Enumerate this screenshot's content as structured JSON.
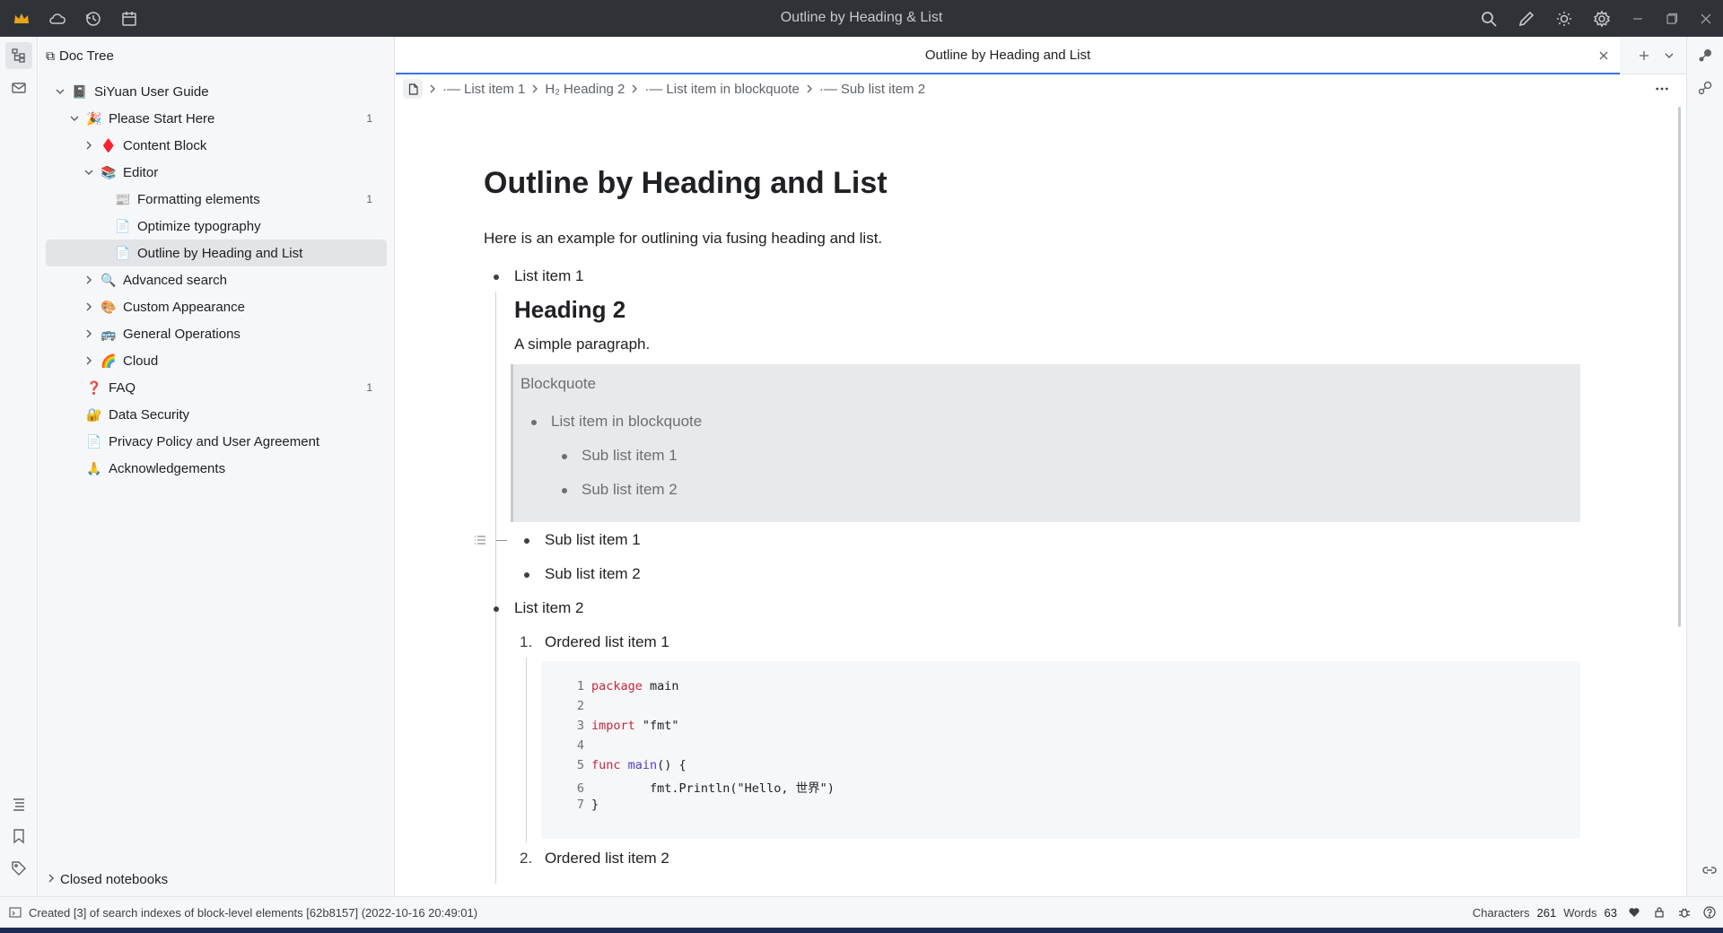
{
  "window": {
    "title": "Outline by Heading & List"
  },
  "titlebar": {
    "left_icons": [
      "crown-icon",
      "cloud-icon",
      "history-icon",
      "calendar-icon"
    ],
    "right_icons": [
      "search-icon",
      "pen-icon",
      "sun-icon",
      "gear-icon"
    ],
    "window_controls": [
      "minimize-icon",
      "maximize-icon",
      "close-icon"
    ]
  },
  "doc_tree": {
    "header": "Doc Tree",
    "items": [
      {
        "label": "SiYuan User Guide",
        "emoji": "📓",
        "depth": 0,
        "toggle": "expanded",
        "count": ""
      },
      {
        "label": "Please Start Here",
        "emoji": "🎉",
        "depth": 1,
        "toggle": "expanded",
        "count": "1"
      },
      {
        "label": "Content Block",
        "emoji": "♦️",
        "depth": 2,
        "toggle": "collapsed",
        "count": ""
      },
      {
        "label": "Editor",
        "emoji": "📚",
        "depth": 2,
        "toggle": "expanded",
        "count": ""
      },
      {
        "label": "Formatting elements",
        "emoji": "📰",
        "depth": 3,
        "toggle": "none",
        "count": "1"
      },
      {
        "label": "Optimize typography",
        "emoji": "📄",
        "depth": 3,
        "toggle": "none",
        "count": ""
      },
      {
        "label": "Outline by Heading and List",
        "emoji": "📄",
        "depth": 3,
        "toggle": "none",
        "count": "",
        "selected": true
      },
      {
        "label": "Advanced search",
        "emoji": "🔍",
        "depth": 2,
        "toggle": "collapsed",
        "count": ""
      },
      {
        "label": "Custom Appearance",
        "emoji": "🎨",
        "depth": 2,
        "toggle": "collapsed",
        "count": ""
      },
      {
        "label": "General Operations",
        "emoji": "🚌",
        "depth": 2,
        "toggle": "collapsed",
        "count": ""
      },
      {
        "label": "Cloud",
        "emoji": "🌈",
        "depth": 2,
        "toggle": "collapsed",
        "count": ""
      },
      {
        "label": "FAQ",
        "emoji": "❓",
        "depth": 1,
        "toggle": "none",
        "count": "1"
      },
      {
        "label": "Data Security",
        "emoji": "🔐",
        "depth": 1,
        "toggle": "none",
        "count": ""
      },
      {
        "label": "Privacy Policy and User Agreement",
        "emoji": "📄",
        "depth": 1,
        "toggle": "none",
        "count": ""
      },
      {
        "label": "Acknowledgements",
        "emoji": "🙏",
        "depth": 1,
        "toggle": "none",
        "count": ""
      }
    ],
    "closed_notebooks": "Closed notebooks"
  },
  "tab": {
    "label": "Outline by Heading and List"
  },
  "breadcrumb": {
    "items": [
      {
        "label": "List item 1",
        "prefix": "·—"
      },
      {
        "label": "Heading 2",
        "prefix": "H₂"
      },
      {
        "label": "List item in blockquote",
        "prefix": "·—"
      },
      {
        "label": "Sub list item 2",
        "prefix": "·—"
      }
    ]
  },
  "editor": {
    "title": "Outline by Heading and List",
    "intro": "Here is an example for outlining via fusing heading and list.",
    "list_item_1": "List item 1",
    "heading2": "Heading 2",
    "paragraph": "A simple paragraph.",
    "blockquote": {
      "title": "Blockquote",
      "item": "List item in blockquote",
      "sub1": "Sub list item 1",
      "sub2": "Sub list item 2"
    },
    "sub_item_1": "Sub list item 1",
    "sub_item_2": "Sub list item 2",
    "list_item_2": "List item 2",
    "ordered": [
      {
        "num": "1.",
        "label": "Ordered list item 1"
      },
      {
        "num": "2.",
        "label": "Ordered list item 2"
      }
    ],
    "code_lines": [
      {
        "n": "1",
        "tokens": [
          {
            "t": "package",
            "c": "kw"
          },
          {
            "t": " main",
            "c": ""
          }
        ]
      },
      {
        "n": "2",
        "tokens": []
      },
      {
        "n": "3",
        "tokens": [
          {
            "t": "import",
            "c": "kw"
          },
          {
            "t": " \"fmt\"",
            "c": ""
          }
        ]
      },
      {
        "n": "4",
        "tokens": []
      },
      {
        "n": "5",
        "tokens": [
          {
            "t": "func",
            "c": "kw"
          },
          {
            "t": " ",
            "c": ""
          },
          {
            "t": "main",
            "c": "fn"
          },
          {
            "t": "() {",
            "c": ""
          }
        ]
      },
      {
        "n": "6",
        "tokens": [
          {
            "t": "        fmt.Println(\"Hello, 世界\")",
            "c": ""
          }
        ]
      },
      {
        "n": "7",
        "tokens": [
          {
            "t": "}",
            "c": ""
          }
        ]
      }
    ]
  },
  "statusbar": {
    "message": "Created [3] of search indexes of block-level elements [62b8157] (2022-10-16 20:49:01)",
    "characters_label": "Characters",
    "characters_value": "261",
    "words_label": "Words",
    "words_value": "63"
  },
  "colors": {
    "accent": "#3575f0",
    "titlebar": "#2f3237",
    "code_keyword": "#c5283d",
    "code_function": "#5a3bc4"
  }
}
